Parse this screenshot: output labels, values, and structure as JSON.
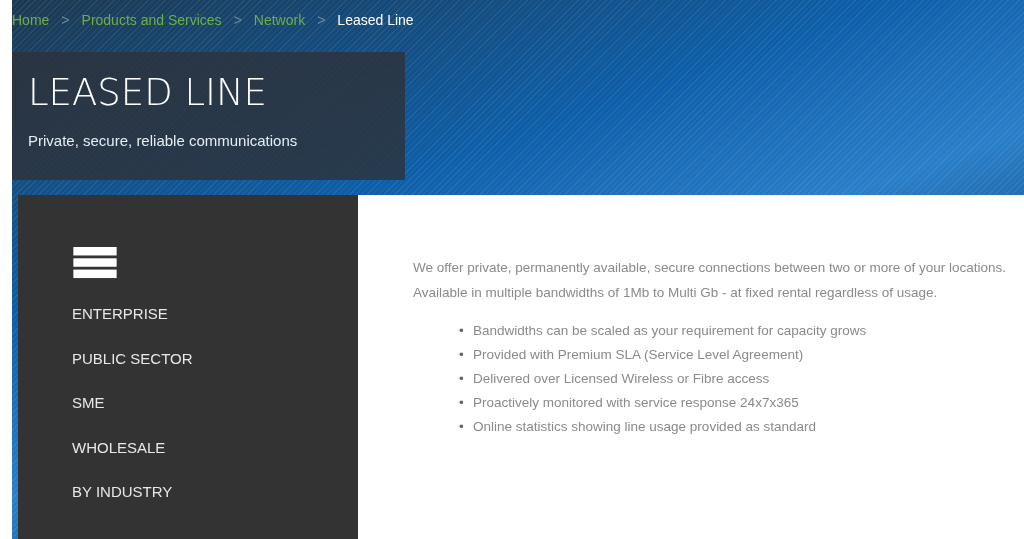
{
  "breadcrumb": [
    {
      "kind": "link",
      "label": "Home"
    },
    {
      "kind": "separator",
      "label": ">"
    },
    {
      "kind": "link",
      "label": "Products and Services"
    },
    {
      "kind": "separator",
      "label": ">"
    },
    {
      "kind": "link",
      "label": "Network"
    },
    {
      "kind": "separator",
      "label": ">"
    },
    {
      "kind": "current",
      "label": "Leased Line"
    }
  ],
  "hero": {
    "title": "LEASED LINE",
    "subtitle": "Private, secure, reliable communications"
  },
  "sidebar": {
    "items": [
      "ENTERPRISE",
      "PUBLIC SECTOR",
      "SME",
      "WHOLESALE",
      "BY INDUSTRY"
    ]
  },
  "content": {
    "intro": "We offer private, permanently available, secure connections between two or more of your locations. Available in multiple bandwidths of 1Mb to Multi Gb - at fixed rental regardless of usage.",
    "bullets": [
      {
        "marker": "•",
        "text": "Bandwidths can be scaled as your requirement for capacity grows"
      },
      {
        "marker": "•",
        "text": "Provided with Premium SLA (Service Level Agreement)"
      },
      {
        "marker": "•",
        "text": "Delivered over Licensed Wireless or Fibre access"
      },
      {
        "marker": "•",
        "text": "Proactively monitored with service response 24x7x365"
      },
      {
        "marker": "•",
        "text": "Online statistics showing line usage provided as standard"
      }
    ]
  }
}
